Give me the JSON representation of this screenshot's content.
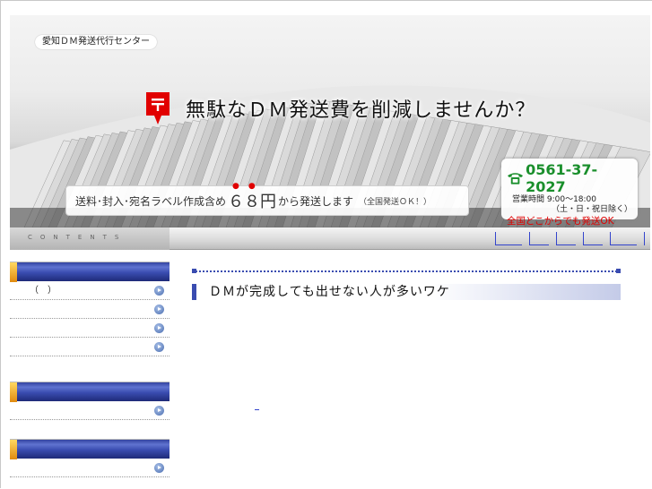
{
  "header": {
    "site_tag": "愛知ＤＭ発送代行センター",
    "headline": "無駄なＤＭ発送費を削減しませんか？",
    "banner_prefix": "送料･封入･宛名ラベル作成含め",
    "banner_price": "６８",
    "banner_price_unit": "円",
    "banner_suffix": "から発送します",
    "banner_note": "（全国発送ＯＫ！）",
    "contact": {
      "phone": "0561-37-2027",
      "hours": "営業時間 9:00～18:00",
      "closed": "（土・日・祝日除く）",
      "nationwide": "全国どこからでも発送OK"
    }
  },
  "nav": {
    "contents_label": "CONTENTS",
    "link_count": 5
  },
  "sidebar": {
    "groups": [
      {
        "items": [
          "（　）",
          "",
          "",
          ""
        ]
      },
      {
        "items": [
          ""
        ]
      },
      {
        "items": [
          ""
        ]
      }
    ]
  },
  "main": {
    "section_title": "ＤＭが完成しても出せない人が多いワケ"
  },
  "colors": {
    "accent_blue": "#3a4cb0",
    "phone_green": "#1a8f2c",
    "alert_red": "#e00000",
    "link_blue": "#3344cc"
  },
  "icons": {
    "post": "japan-post-mark-icon",
    "phone": "telephone-icon",
    "arrow": "arrow-right-circle-icon"
  }
}
